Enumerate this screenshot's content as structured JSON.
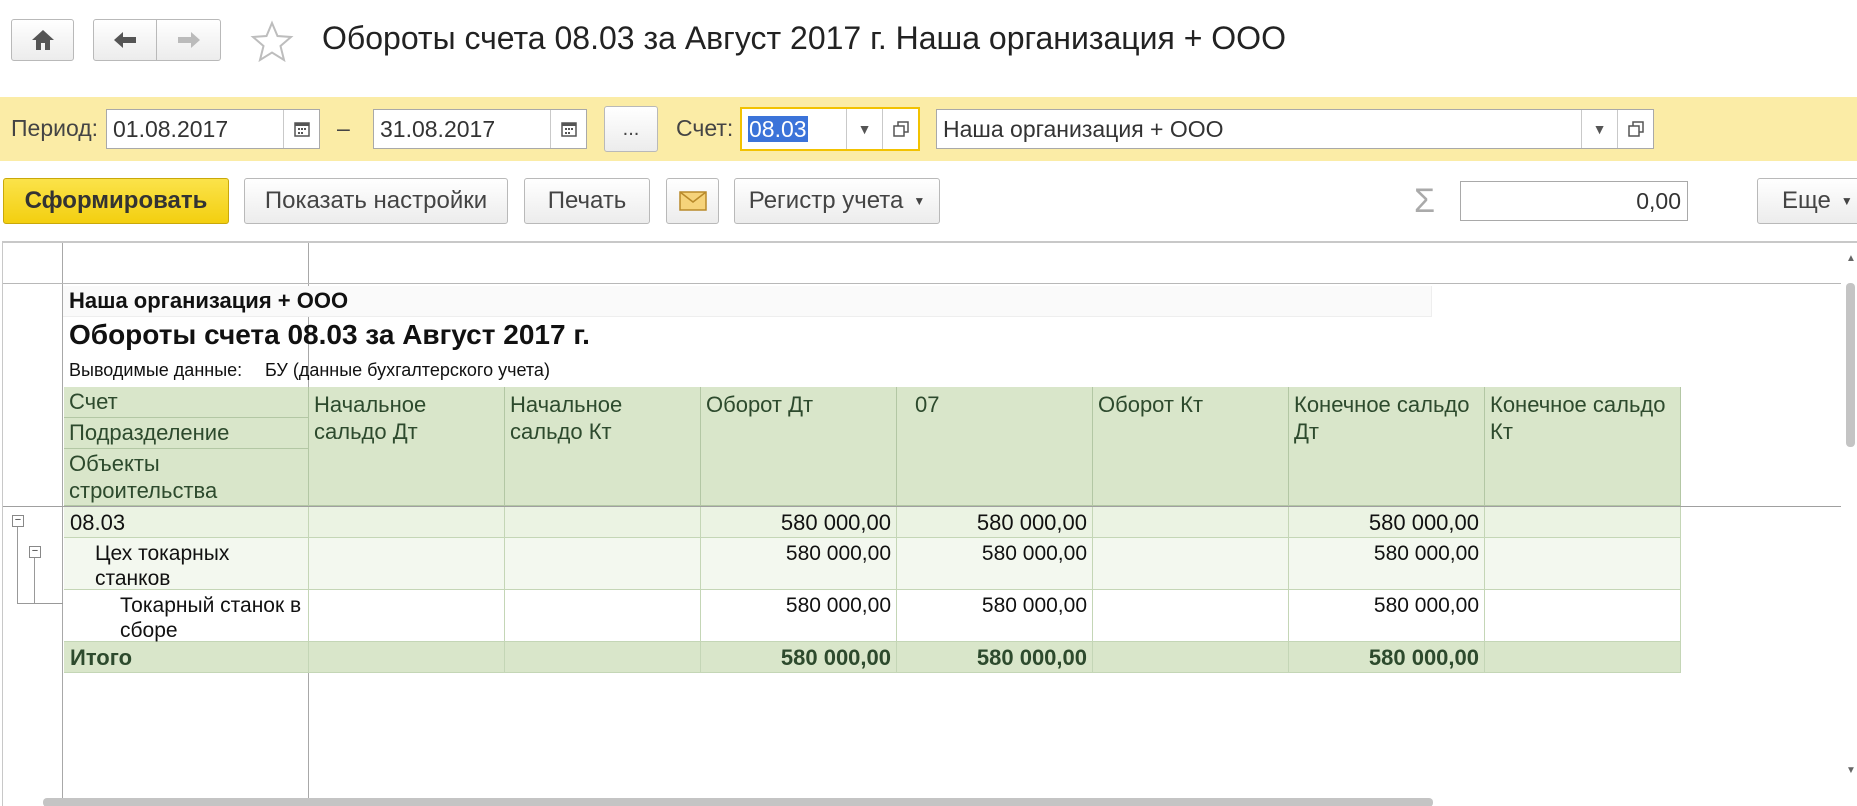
{
  "window": {
    "title": "Обороты счета 08.03 за Август 2017 г. Наша организация + ООО",
    "home_icon": "home-icon",
    "back_icon": "arrow-left-icon",
    "forward_icon": "arrow-right-icon",
    "favorite_icon": "star-icon"
  },
  "filters": {
    "period_label": "Период:",
    "date_from": "01.08.2017",
    "date_dash": "–",
    "date_to": "31.08.2017",
    "period_select_label": "...",
    "account_label": "Счет:",
    "account_value": "08.03",
    "organization_value": "Наша организация + ООО"
  },
  "toolbar": {
    "generate_label": "Сформировать",
    "settings_label": "Показать настройки",
    "print_label": "Печать",
    "register_label": "Регистр учета",
    "sum_value": "0,00",
    "more_label": "Еще"
  },
  "report": {
    "organization": "Наша организация + ООО",
    "title": "Обороты счета 08.03 за Август 2017 г.",
    "output_label": "Выводимые данные:",
    "output_value": "БУ (данные бухгалтерского учета)",
    "header_groups": [
      "Счет",
      "Подразделение",
      "Объекты строительства"
    ],
    "columns": [
      "Начальное сальдо Дт",
      "Начальное сальдо Кт",
      "Оборот Дт",
      "07",
      "Оборот Кт",
      "Конечное сальдо Дт",
      "Конечное сальдо Кт"
    ],
    "rows": [
      {
        "name": "08.03",
        "values": [
          "",
          "",
          "580 000,00",
          "580 000,00",
          "",
          "580 000,00",
          ""
        ]
      },
      {
        "name": "Цех токарных станков",
        "values": [
          "",
          "",
          "580 000,00",
          "580 000,00",
          "",
          "580 000,00",
          ""
        ]
      },
      {
        "name": "Токарный станок в сборе",
        "values": [
          "",
          "",
          "580 000,00",
          "580 000,00",
          "",
          "580 000,00",
          ""
        ]
      }
    ],
    "total": {
      "name": "Итого",
      "values": [
        "",
        "",
        "580 000,00",
        "580 000,00",
        "",
        "580 000,00",
        ""
      ]
    }
  },
  "colors": {
    "filter_bar": "#fbeca6",
    "generate_button": "#f6d419",
    "table_header": "#d9e6ca",
    "accent_border": "#f2c200"
  }
}
